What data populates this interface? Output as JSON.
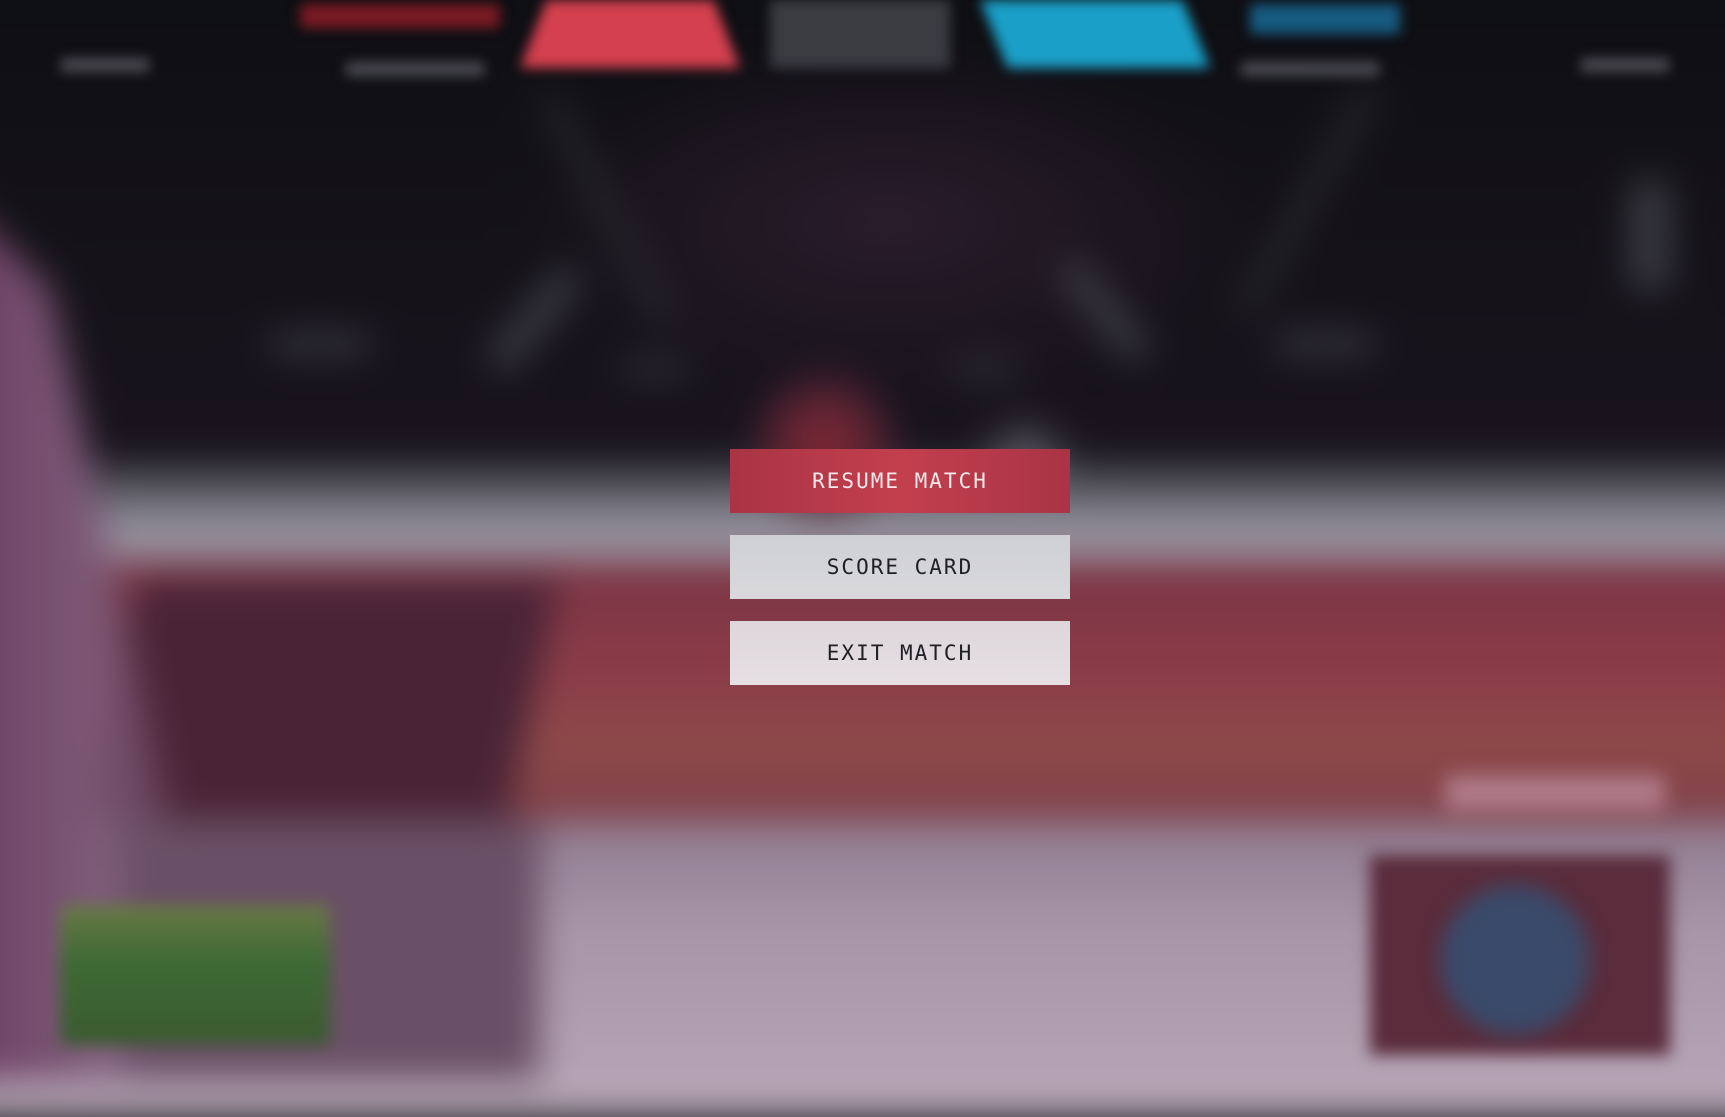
{
  "pause_menu": {
    "buttons": [
      {
        "label": "RESUME MATCH",
        "color": "#c33f4e",
        "state": "highlighted"
      },
      {
        "label": "SCORE CARD",
        "color": "#d6d6d9"
      },
      {
        "label": "EXIT MATCH",
        "color": "#e3dce0"
      }
    ]
  },
  "hud": {
    "team_colors": {
      "red": "#d4404e",
      "blue": "#1aa0c8"
    }
  }
}
